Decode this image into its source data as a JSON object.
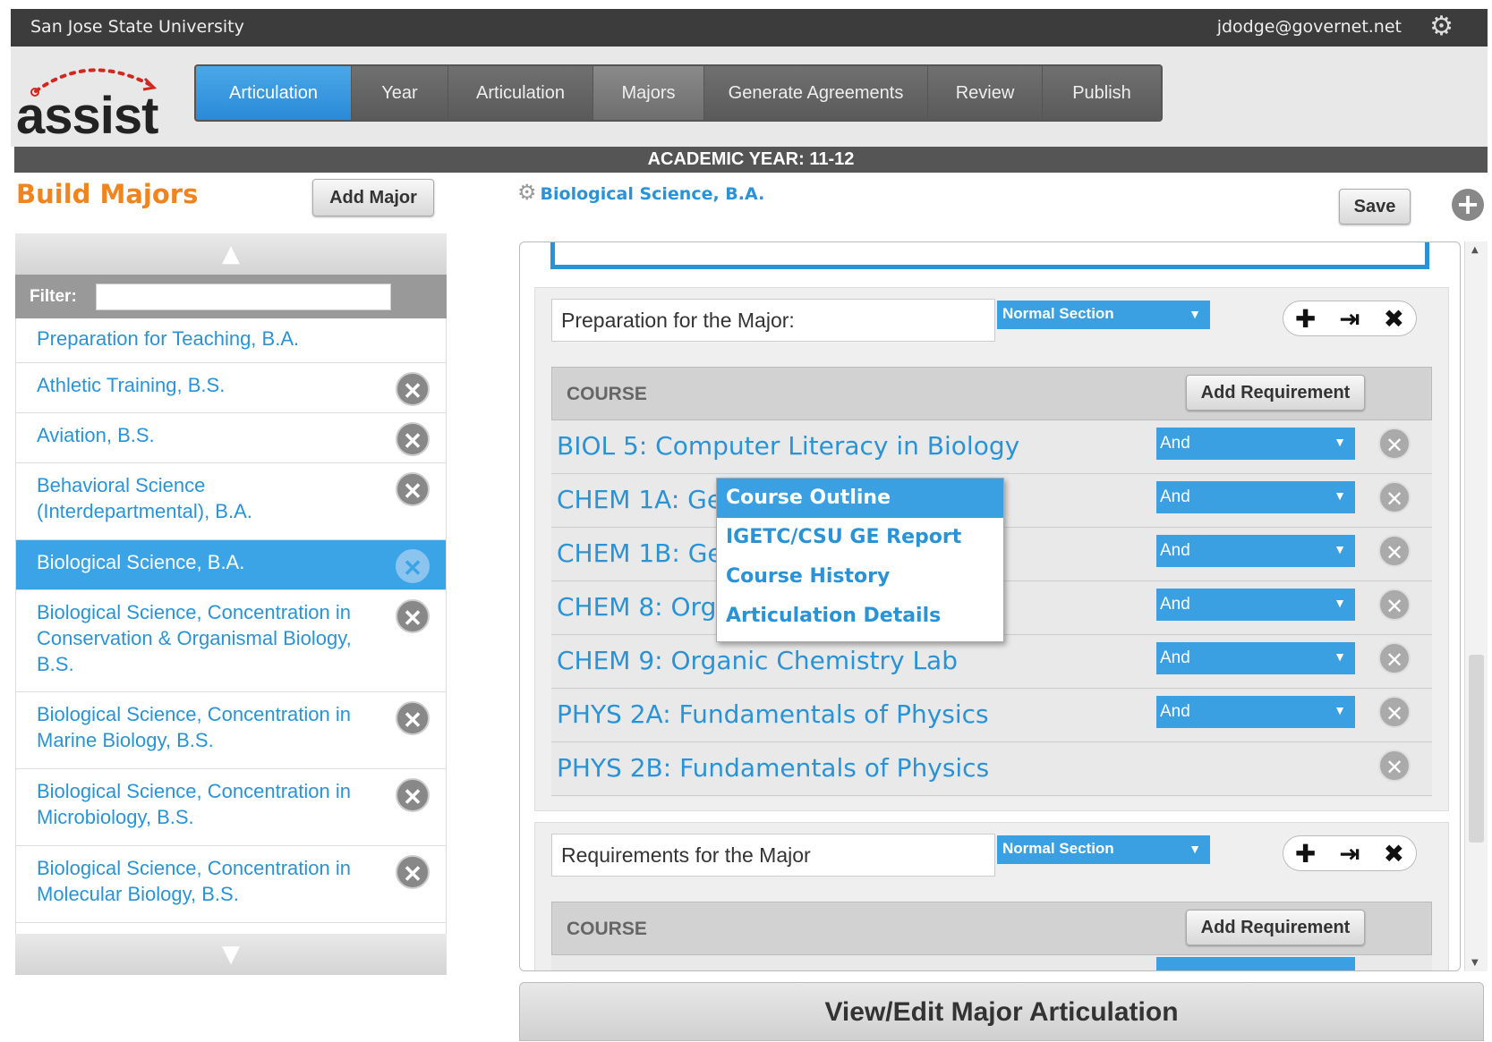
{
  "top_bar": {
    "university": "San Jose State University",
    "user_email": "jdodge@governet.net",
    "settings_icon": "gear-icon"
  },
  "logo": {
    "text": "assist"
  },
  "nav": {
    "tabs": [
      "Articulation",
      "Year",
      "Articulation",
      "Majors",
      "Generate Agreements",
      "Review",
      "Publish"
    ],
    "active_tab": "Articulation"
  },
  "academic_year": "ACADEMIC YEAR: 11-12",
  "left": {
    "title": "Build Majors",
    "add_major_label": "Add Major",
    "filter_label": "Filter:",
    "filter_value": "",
    "majors": [
      "Preparation for Teaching, B.A.",
      "Athletic Training, B.S.",
      "Aviation, B.S.",
      "Behavioral Science (Interdepartmental), B.A.",
      "Biological Science, B.A.",
      "Biological Science, Concentration in Conservation & Organismal Biology, B.S.",
      "Biological Science, Concentration in Marine Biology, B.S.",
      "Biological Science, Concentration in Microbiology, B.S.",
      "Biological Science, Concentration in Molecular Biology, B.S."
    ],
    "selected_major": "Biological Science, B.A."
  },
  "main": {
    "major_title": "Biological Science, B.A.",
    "save_label": "Save",
    "sections": [
      {
        "name": "Preparation for the Major:",
        "type": "Normal Section",
        "course_header": "COURSE",
        "add_requirement_label": "Add Requirement",
        "courses": [
          {
            "title": "BIOL 5: Computer Literacy in Biology",
            "connector": "And"
          },
          {
            "title": "CHEM 1A: Ge",
            "connector": "And"
          },
          {
            "title": "CHEM 1B: Ge",
            "connector": "And"
          },
          {
            "title": "CHEM 8: Orga",
            "connector": "And"
          },
          {
            "title": "CHEM 9: Organic Chemistry Lab",
            "connector": "And"
          },
          {
            "title": "PHYS 2A: Fundamentals of Physics",
            "connector": "And"
          },
          {
            "title": "PHYS 2B: Fundamentals of Physics",
            "connector": ""
          }
        ]
      },
      {
        "name": "Requirements for the Major",
        "type": "Normal Section",
        "course_header": "COURSE",
        "add_requirement_label": "Add Requirement",
        "courses": []
      }
    ],
    "context_menu": {
      "items": [
        "Course Outline",
        "IGETC/CSU GE Report",
        "Course History",
        "Articulation Details"
      ],
      "active_item": "Course Outline"
    },
    "footer_button": "View/Edit Major Articulation"
  },
  "colors": {
    "accent": "#2a93d5",
    "brand_orange": "#f0841f",
    "topbar": "#3c3c3c"
  }
}
